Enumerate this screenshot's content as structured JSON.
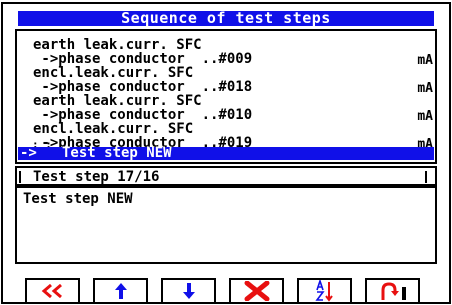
{
  "window": {
    "title": "Sequence of test steps"
  },
  "steps": [
    {
      "name": "earth leak.curr. SFC",
      "detail": " ->phase conductor  ..#009",
      "unit": "mA"
    },
    {
      "name": "encl.leak.curr. SFC",
      "detail": " ->phase conductor  ..#018",
      "unit": "mA"
    },
    {
      "name": "earth leak.curr. SFC",
      "detail": " ->phase conductor  ..#010",
      "unit": "mA"
    },
    {
      "name": "encl.leak.curr. SFC",
      "detail": " ->phase conductor  ..#019",
      "unit": "mA"
    }
  ],
  "selected": {
    "dots": ": :",
    "arrow": "->",
    "label": "Test step NEW"
  },
  "status": {
    "text": "Test step 17/16"
  },
  "description": {
    "text": "Test step NEW"
  },
  "toolbar": {
    "buttons": [
      {
        "icon": "double-left-chevron-icon"
      },
      {
        "icon": "arrow-up-icon"
      },
      {
        "icon": "arrow-down-icon"
      },
      {
        "icon": "delete-x-icon"
      },
      {
        "icon": "sort-a-z-icon"
      },
      {
        "icon": "return-arrow-icon"
      }
    ]
  },
  "colors": {
    "highlight": "#1010e8",
    "danger": "#e81010"
  }
}
